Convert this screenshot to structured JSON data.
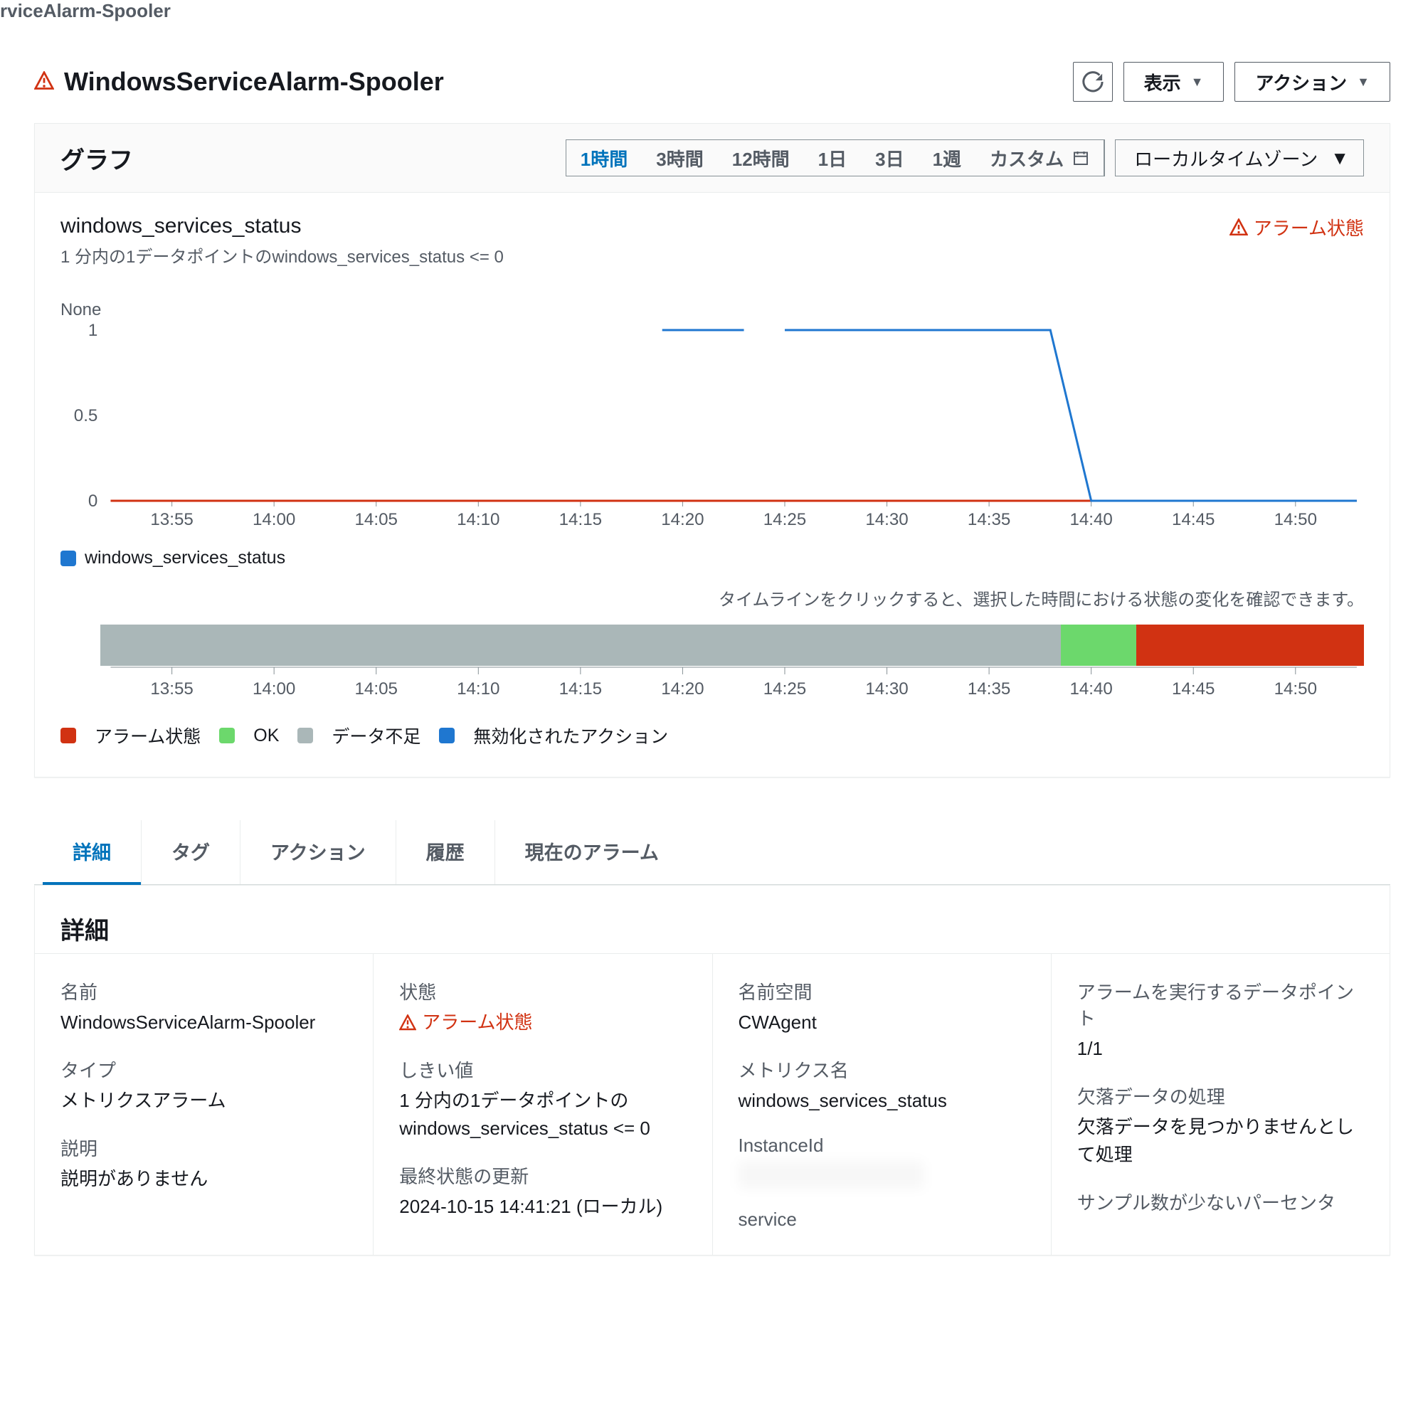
{
  "breadcrumb_suffix": "rviceAlarm-Spooler",
  "title": "WindowsServiceAlarm-Spooler",
  "buttons": {
    "display": "表示",
    "actions": "アクション"
  },
  "graph_header": "グラフ",
  "range": {
    "items": [
      "1時間",
      "3時間",
      "12時間",
      "1日",
      "3日",
      "1週"
    ],
    "active": "1時間",
    "custom": "カスタム",
    "tz": "ローカルタイムゾーン"
  },
  "chart": {
    "title": "windows_services_status",
    "sub": "1 分内の1データポイントのwindows_services_status <= 0",
    "alarm_state": "アラーム状態",
    "none_label": "None",
    "legend_series": "windows_services_status",
    "timeline_hint": "タイムラインをクリックすると、選択した時間における状態の変化を確認できます。"
  },
  "timeline_legend": {
    "alarm": "アラーム状態",
    "ok": "OK",
    "insufficient": "データ不足",
    "disabled": "無効化されたアクション"
  },
  "tabs": [
    "詳細",
    "タグ",
    "アクション",
    "履歴",
    "現在のアラーム"
  ],
  "active_tab": "詳細",
  "details": {
    "header": "詳細",
    "name_label": "名前",
    "name_value": "WindowsServiceAlarm-Spooler",
    "type_label": "タイプ",
    "type_value": "メトリクスアラーム",
    "desc_label": "説明",
    "desc_value": "説明がありません",
    "state_label": "状態",
    "state_value": "アラーム状態",
    "threshold_label": "しきい値",
    "threshold_value": "1 分内の1データポイントのwindows_services_status <= 0",
    "last_update_label": "最終状態の更新",
    "last_update_value": "2024-10-15 14:41:21 (ローカル)",
    "namespace_label": "名前空間",
    "namespace_value": "CWAgent",
    "metric_label": "メトリクス名",
    "metric_value": "windows_services_status",
    "instance_label": "InstanceId",
    "instance_value": "i-00000000000000000",
    "service_label": "service",
    "datapoints_label": "アラームを実行するデータポイント",
    "datapoints_value": "1/1",
    "missing_label": "欠落データの処理",
    "missing_value": "欠落データを見つかりませんとして処理",
    "lowcount_label": "サンプル数が少ないパーセンタ"
  },
  "chart_data": {
    "type": "line",
    "xlabel": "",
    "ylabel": "None",
    "title": "windows_services_status",
    "ylim": [
      0,
      1
    ],
    "x_ticks": [
      "13:55",
      "14:00",
      "14:05",
      "14:10",
      "14:15",
      "14:20",
      "14:25",
      "14:30",
      "14:35",
      "14:40",
      "14:45",
      "14:50"
    ],
    "series": [
      {
        "name": "windows_services_status",
        "color": "#1f77d0",
        "points": [
          {
            "x": "14:19",
            "y": 1
          },
          {
            "x": "14:23",
            "y": 1
          },
          {
            "x": "14:25",
            "y": 1
          },
          {
            "x": "14:38",
            "y": 1
          },
          {
            "x": "14:40",
            "y": 0
          },
          {
            "x": "14:53",
            "y": 0
          }
        ],
        "gaps_after": [
          "14:23"
        ]
      },
      {
        "name": "threshold",
        "color": "#d13212",
        "points": [
          {
            "x": "13:52",
            "y": 0
          },
          {
            "x": "14:53",
            "y": 0
          }
        ]
      }
    ],
    "timeline": [
      {
        "state": "insufficient",
        "percent": 76,
        "color": "#aab7b8"
      },
      {
        "state": "ok",
        "percent": 6,
        "color": "#6cd86c"
      },
      {
        "state": "alarm",
        "percent": 18,
        "color": "#d13212"
      }
    ]
  }
}
